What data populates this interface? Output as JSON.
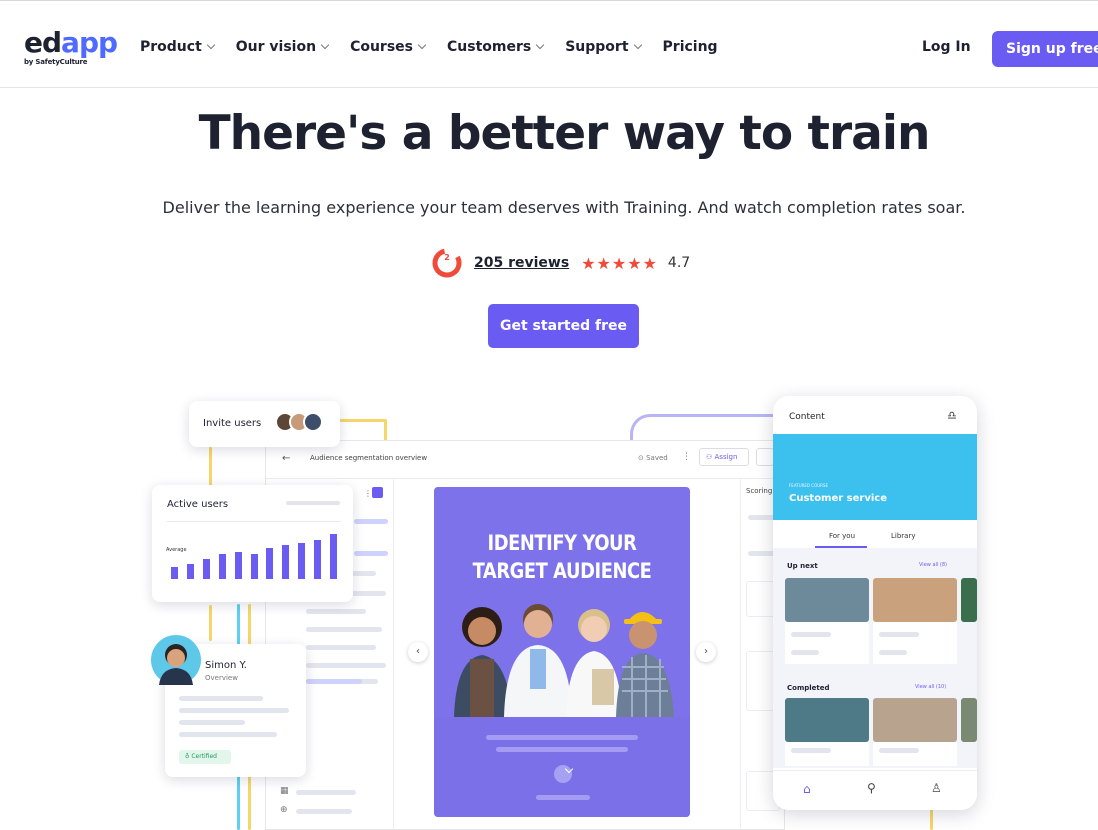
{
  "brand": {
    "name_main": "ed",
    "name_accent": "app",
    "tagline": "by SafetyCulture"
  },
  "nav": {
    "items": [
      {
        "label": "Product",
        "has_menu": true
      },
      {
        "label": "Our vision",
        "has_menu": true
      },
      {
        "label": "Courses",
        "has_menu": true
      },
      {
        "label": "Customers",
        "has_menu": true
      },
      {
        "label": "Support",
        "has_menu": true
      },
      {
        "label": "Pricing",
        "has_menu": false
      }
    ],
    "login_label": "Log In",
    "signup_label": "Sign up free"
  },
  "hero": {
    "title": "There's a better way to train",
    "subtitle": "Deliver the learning experience your team deserves with Training. And watch completion rates soar.",
    "reviews_label": "205 reviews",
    "stars": "★★★★★",
    "score": "4.7",
    "cta_label": "Get started free"
  },
  "illustration": {
    "invite_label": "Invite users",
    "active_users_title": "Active users",
    "active_users_legend": "Average",
    "bars": [
      0.25,
      0.3,
      0.4,
      0.5,
      0.55,
      0.5,
      0.62,
      0.68,
      0.72,
      0.78,
      0.9
    ],
    "dashboard_title": "Audience segmentation overview",
    "saved_label": "Saved",
    "assign_label": "Assign",
    "scoring_label": "Scoring",
    "promo_title_1": "IDENTIFY YOUR",
    "promo_title_2": "TARGET AUDIENCE",
    "profile_name": "Simon Y.",
    "profile_sub": "Overview",
    "certified_label": "Certified",
    "phone": {
      "header": "Content",
      "featured_tag": "FEATURED COURSE",
      "featured_title": "Customer service",
      "tab_for_you": "For you",
      "tab_library": "Library",
      "up_next": "Up next",
      "up_next_link": "View all (8)",
      "completed": "Completed",
      "completed_link": "View all (10)"
    }
  },
  "colors": {
    "accent": "#6a5cf2",
    "star": "#ef4a3a",
    "promo": "#7d72ea",
    "featured": "#3cc1ee",
    "yellow_line": "#f6d66a"
  }
}
